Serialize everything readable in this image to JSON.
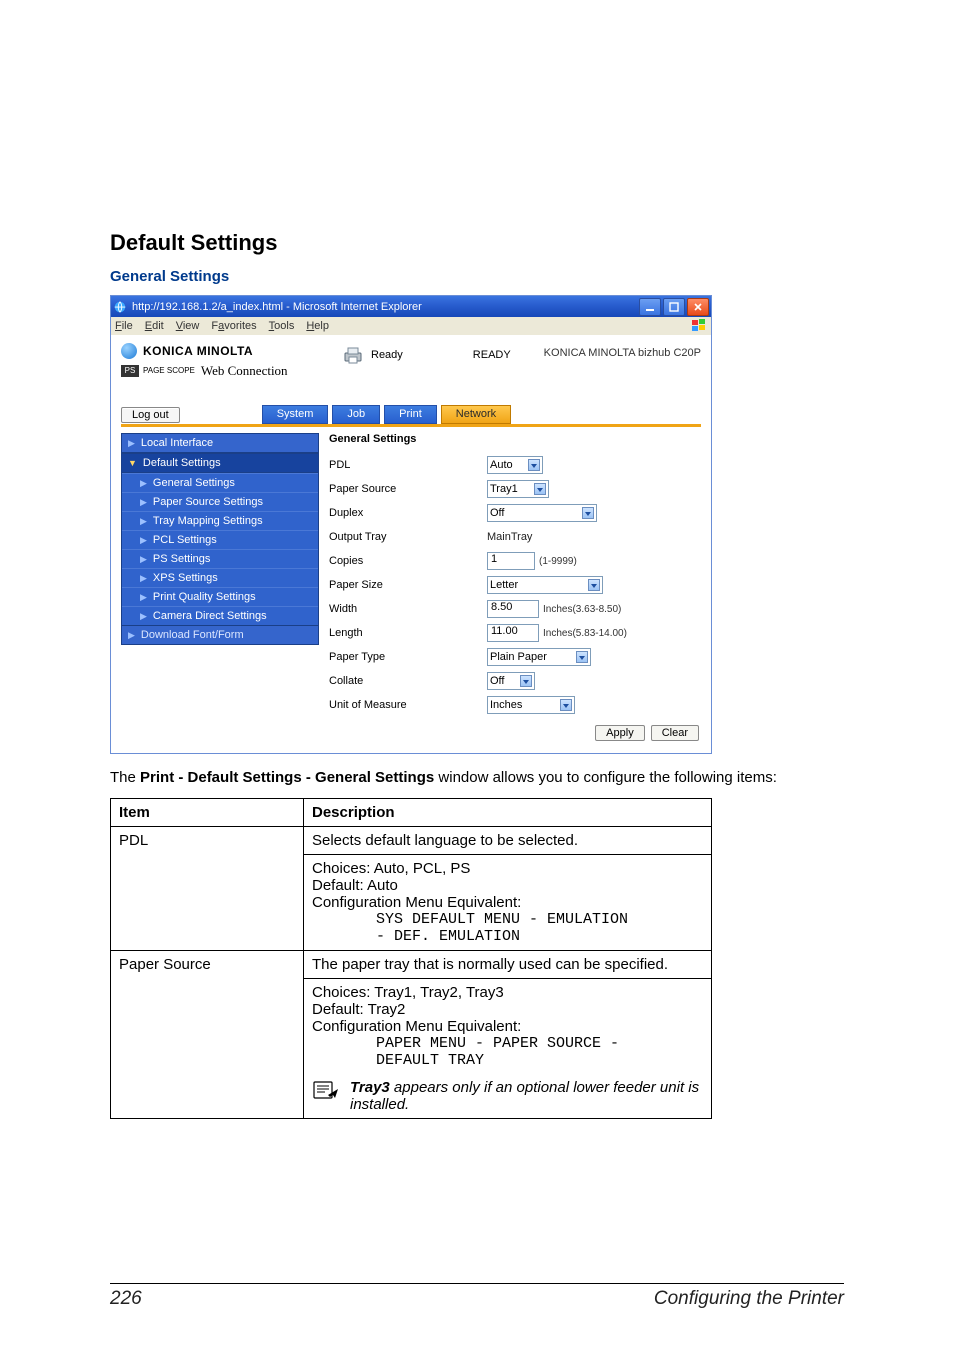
{
  "headings": {
    "h1": "Default Settings",
    "h2": "General Settings"
  },
  "browser": {
    "title": "http://192.168.1.2/a_index.html - Microsoft Internet Explorer",
    "menu": {
      "file": "File",
      "edit": "Edit",
      "view": "View",
      "favorites": "Favorites",
      "tools": "Tools",
      "help": "Help"
    }
  },
  "brand": {
    "km": "KONICA MINOLTA",
    "ps_tag": "PAGE SCOPE",
    "webconn": "Web Connection",
    "ready_label": "Ready",
    "ready_status": "READY",
    "model": "KONICA MINOLTA bizhub C20P"
  },
  "actions": {
    "logout": "Log out",
    "apply": "Apply",
    "clear": "Clear"
  },
  "tabs": {
    "system": "System",
    "job": "Job",
    "print": "Print",
    "network": "Network"
  },
  "sidebar": {
    "local": "Local Interface",
    "default": "Default Settings",
    "general": "General Settings",
    "paper_src": "Paper Source Settings",
    "traymap": "Tray Mapping Settings",
    "pcl": "PCL Settings",
    "ps": "PS Settings",
    "xps": "XPS Settings",
    "pq": "Print Quality Settings",
    "camera": "Camera Direct Settings",
    "download": "Download Font/Form"
  },
  "form": {
    "section": "General Settings",
    "labels": {
      "pdl": "PDL",
      "paper_source": "Paper Source",
      "duplex": "Duplex",
      "output_tray": "Output Tray",
      "copies": "Copies",
      "paper_size": "Paper Size",
      "width": "Width",
      "length": "Length",
      "paper_type": "Paper Type",
      "collate": "Collate",
      "uom": "Unit of Measure"
    },
    "values": {
      "pdl": "Auto",
      "paper_source": "Tray1",
      "duplex": "Off",
      "output_tray": "MainTray",
      "copies": "1",
      "copies_hint": "(1-9999)",
      "paper_size": "Letter",
      "width": "8.50",
      "width_hint": "Inches(3.63-8.50)",
      "length": "11.00",
      "length_hint": "Inches(5.83-14.00)",
      "paper_type": "Plain Paper",
      "collate": "Off",
      "uom": "Inches"
    }
  },
  "paragraph": {
    "pre": "The ",
    "bold": "Print - Default Settings - General Settings",
    "post": " window allows you to configure the following items:"
  },
  "table": {
    "head_item": "Item",
    "head_desc": "Description",
    "rows": {
      "pdl": {
        "item": "PDL",
        "line1": "Selects default language to be selected.",
        "line2": "Choices: Auto, PCL, PS",
        "line3": "Default:  Auto",
        "line4": "Configuration Menu Equivalent:",
        "mono1": "SYS DEFAULT MENU - EMULATION",
        "mono2": "- DEF. EMULATION"
      },
      "psrc": {
        "item": "Paper Source",
        "line1": "The paper tray that is normally used can be specified.",
        "line2": "Choices: Tray1, Tray2, Tray3",
        "line3": "Default:  Tray2",
        "line4": "Configuration Menu Equivalent:",
        "mono1": "PAPER MENU - PAPER SOURCE -",
        "mono2": "DEFAULT TRAY",
        "note_b": "Tray3",
        "note_rest": " appears only if an optional lower feeder unit is installed."
      }
    }
  },
  "footer": {
    "page": "226",
    "section": "Configuring the Printer"
  }
}
